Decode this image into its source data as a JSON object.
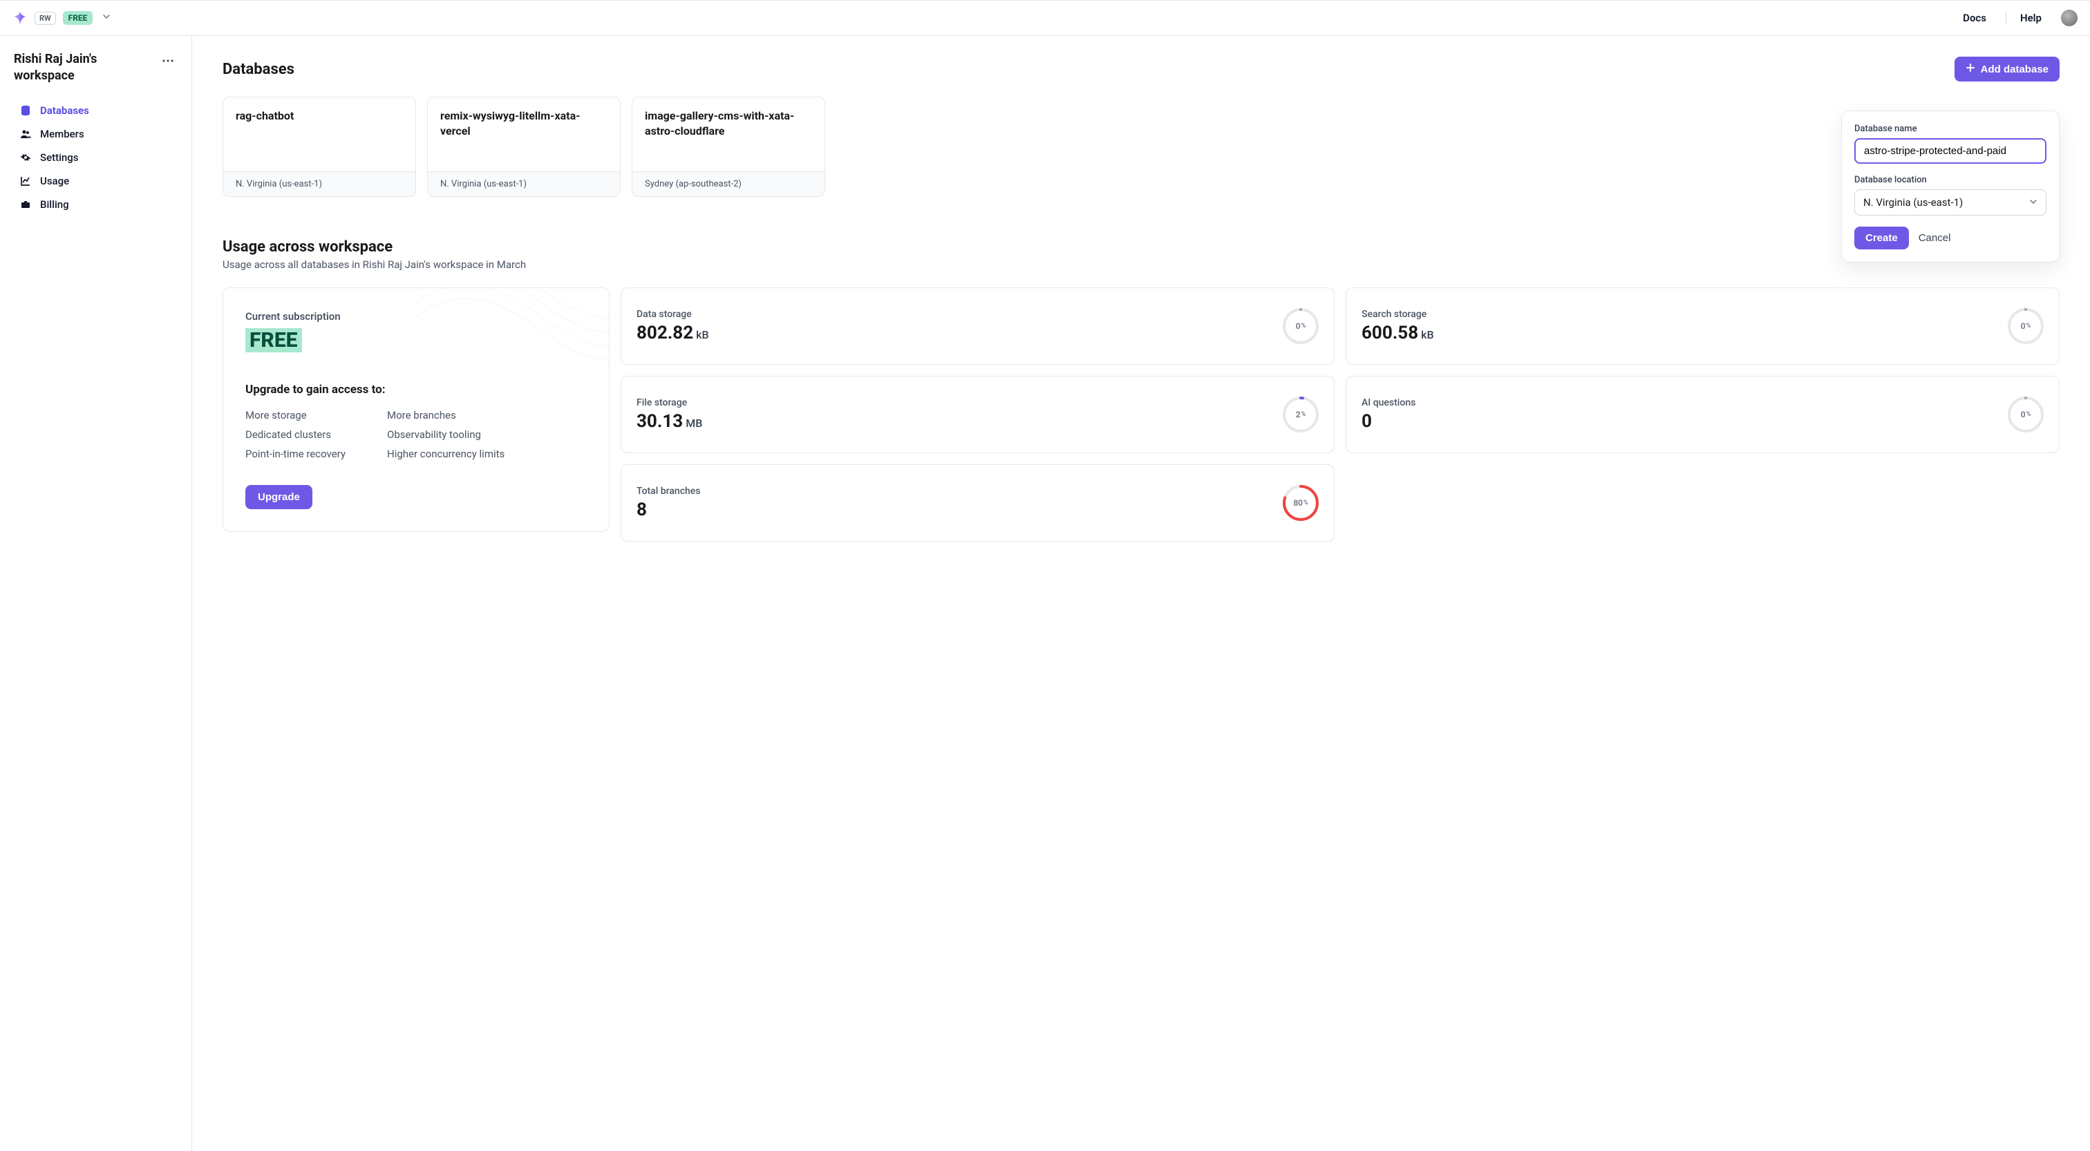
{
  "topbar": {
    "workspace_badge": "RW",
    "plan_badge": "FREE",
    "docs": "Docs",
    "help": "Help"
  },
  "sidebar": {
    "workspace_name": "Rishi Raj Jain's workspace",
    "items": [
      {
        "label": "Databases",
        "active": true
      },
      {
        "label": "Members",
        "active": false
      },
      {
        "label": "Settings",
        "active": false
      },
      {
        "label": "Usage",
        "active": false
      },
      {
        "label": "Billing",
        "active": false
      }
    ]
  },
  "page": {
    "title": "Databases",
    "add_button": "Add database"
  },
  "databases": [
    {
      "name": "rag-chatbot",
      "region": "N. Virginia (us-east-1)"
    },
    {
      "name": "remix-wysiwyg-litellm-xata-vercel",
      "region": "N. Virginia (us-east-1)"
    },
    {
      "name": "image-gallery-cms-with-xata-astro-cloudflare",
      "region": "Sydney (ap-southeast-2)"
    }
  ],
  "popover": {
    "name_label": "Database name",
    "name_value": "astro-stripe-protected-and-paid",
    "location_label": "Database location",
    "location_value": "N. Virginia (us-east-1)",
    "create": "Create",
    "cancel": "Cancel"
  },
  "usage": {
    "heading": "Usage across workspace",
    "subheading": "Usage across all databases in Rishi Raj Jain's workspace in March",
    "current_sub_label": "Current subscription",
    "plan": "FREE",
    "upgrade_heading": "Upgrade to gain access to:",
    "features_left": [
      "More storage",
      "Dedicated clusters",
      "Point-in-time recovery"
    ],
    "features_right": [
      "More branches",
      "Observability tooling",
      "Higher concurrency limits"
    ],
    "upgrade_button": "Upgrade"
  },
  "metrics": [
    {
      "label": "Data storage",
      "value": "802.82",
      "unit": "kB",
      "percent": 0,
      "color": "#9ca3af"
    },
    {
      "label": "Search storage",
      "value": "600.58",
      "unit": "kB",
      "percent": 0,
      "color": "#9ca3af"
    },
    {
      "label": "File storage",
      "value": "30.13",
      "unit": "MB",
      "percent": 2,
      "color": "#6e59e6"
    },
    {
      "label": "AI questions",
      "value": "0",
      "unit": "",
      "percent": 0,
      "color": "#9ca3af"
    },
    {
      "label": "Total branches",
      "value": "8",
      "unit": "",
      "percent": 80,
      "color": "#ef4444"
    }
  ]
}
